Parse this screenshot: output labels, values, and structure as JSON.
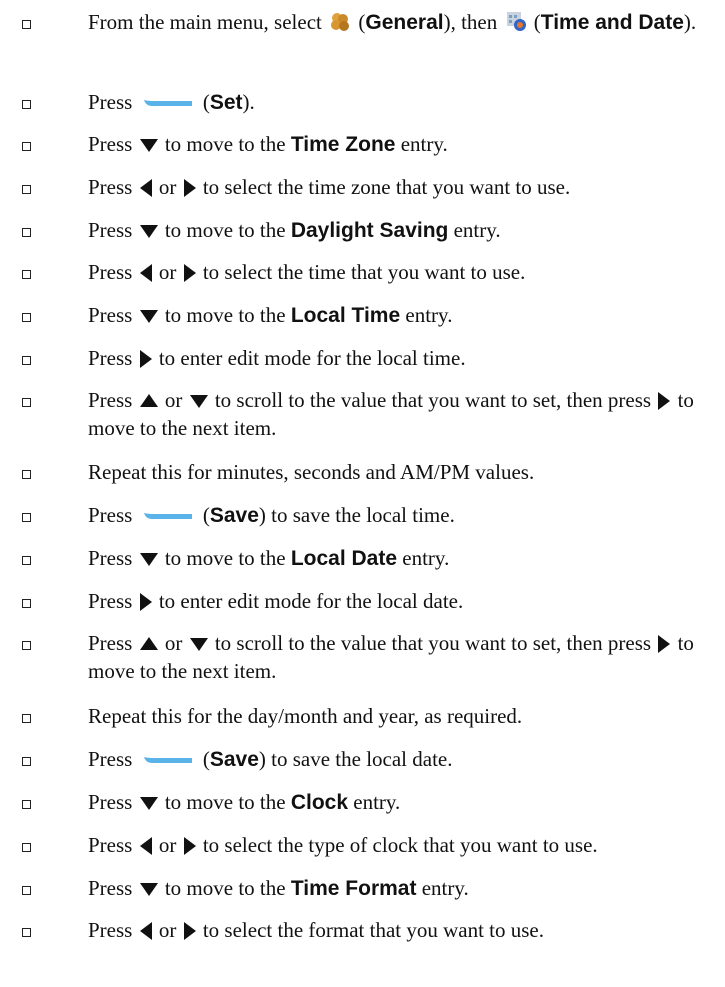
{
  "icon_colors": {
    "softkey": "#5ab3e8",
    "general": "#c98a2b",
    "time_date": "#7a9fc4"
  },
  "steps": [
    {
      "a": "From the main menu, select ",
      "b": " (",
      "c": "General",
      "d": "), then ",
      "e": " (",
      "f": "Time and Date",
      "g": ")."
    },
    {
      "a": "Press ",
      "b": " (",
      "c": "Set",
      "d": ")."
    },
    {
      "a": "Press ",
      "b": " to move to the ",
      "c": "Time Zone",
      "d": " entry."
    },
    {
      "a": "Press ",
      "b": " or ",
      "c": " to select the time zone that you want to use."
    },
    {
      "a": "Press ",
      "b": " to move to the ",
      "c": "Daylight Saving",
      "d": " entry."
    },
    {
      "a": "Press ",
      "b": " or ",
      "c": " to select the time that you want to use."
    },
    {
      "a": "Press ",
      "b": " to move to the ",
      "c": "Local Time",
      "d": " entry."
    },
    {
      "a": "Press ",
      "b": " to enter edit mode for the local time."
    },
    {
      "a": "Press ",
      "b": " or ",
      "c": " to scroll to the value that you want to set, then press ",
      "d": " to move to the next item."
    },
    {
      "a": "Repeat this for minutes, seconds and AM/PM values."
    },
    {
      "a": "Press ",
      "b": " (",
      "c": "Save",
      "d": ") to save the local time."
    },
    {
      "a": "Press ",
      "b": " to move to the ",
      "c": "Local Date",
      "d": " entry."
    },
    {
      "a": "Press ",
      "b": " to enter edit mode for the local date."
    },
    {
      "a": "Press ",
      "b": " or ",
      "c": " to scroll to the value that you want to set, then press ",
      "d": " to move to the next item."
    },
    {
      "a": "Repeat this for the day/month and year, as required."
    },
    {
      "a": "Press ",
      "b": " (",
      "c": "Save",
      "d": ") to save the local date."
    },
    {
      "a": "Press ",
      "b": " to move to the ",
      "c": "Clock",
      "d": " entry."
    },
    {
      "a": "Press ",
      "b": " or ",
      "c": " to select the type of clock that you want to use."
    },
    {
      "a": "Press ",
      "b": " to move to the ",
      "c": "Time Format",
      "d": " entry."
    },
    {
      "a": "Press ",
      "b": " or ",
      "c": " to select the format that you want to use."
    }
  ]
}
